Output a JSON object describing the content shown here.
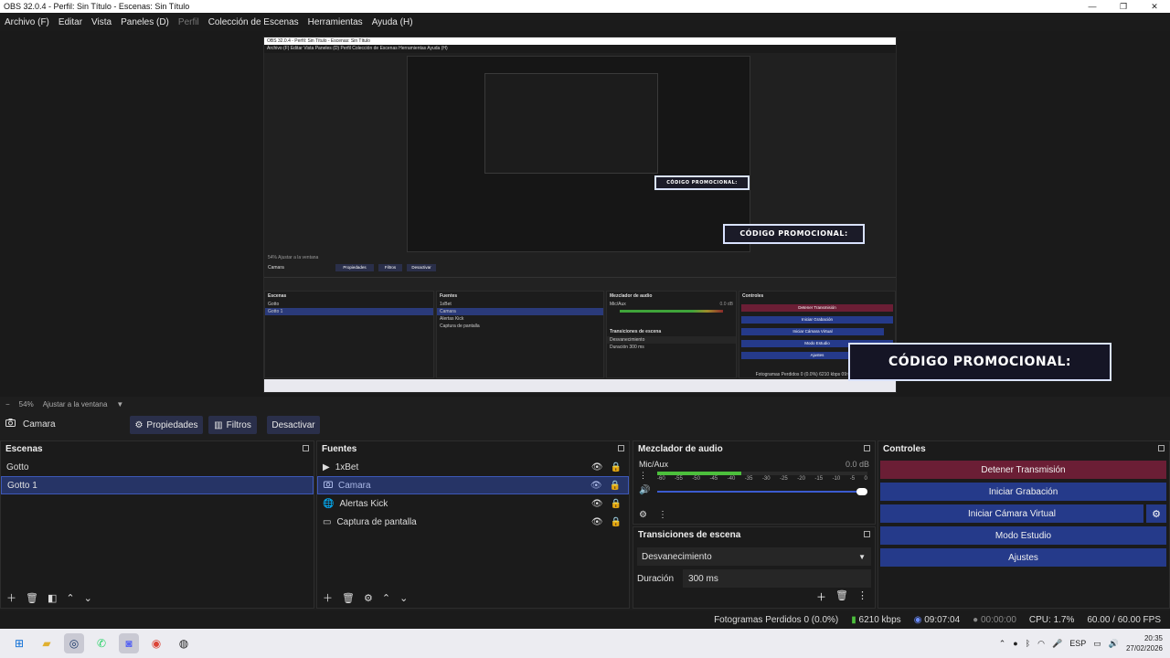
{
  "window": {
    "title": "OBS 32.0.4 - Perfil: Sin Título - Escenas: Sin Título",
    "controls": [
      "—",
      "❐",
      "✕"
    ]
  },
  "menu": [
    "Archivo (F)",
    "Editar",
    "Vista",
    "Paneles (D)",
    "Perfil",
    "Colección de Escenas",
    "Herramientas",
    "Ayuda (H)"
  ],
  "preview": {
    "promo_text": "CÓDIGO PROMOCIONAL:",
    "nested_title": "OBS 32.0.4 - Perfil: Sin Título - Escenas: Sin Título",
    "nested_menu": "Archivo (F)   Editar   Vista   Paneles (D)   Perfil   Colección de Escenas   Herramientas   Ayuda (H)",
    "nested_zoom": "54%    Ajustar a la ventana",
    "nested_camara": "Camara",
    "nested_propiedades": "Propiedades",
    "nested_filtros": "Filtros",
    "nested_desactivar": "Desactivar",
    "nested_escenas": "Escenas",
    "nested_scene1": "Gotto",
    "nested_scene2": "Gotto 1",
    "nested_fuentes": "Fuentes",
    "nested_sources": [
      "1xBet",
      "Camara",
      "Alertas Kick",
      "Captura de pantalla"
    ],
    "nested_mezclador": "Mezclador de audio",
    "nested_micaux": "Mic/Aux",
    "nested_db": "0.0 dB",
    "nested_transiciones": "Transiciones de escena",
    "nested_desvanecimiento": "Desvanecimiento",
    "nested_duracion": "Duración",
    "nested_ms": "300 ms",
    "nested_controles": "Controles",
    "nested_controls": [
      "Detener Transmisión",
      "Iniciar Grabación",
      "Iniciar Cámara Virtual",
      "Modo Estudio",
      "Ajustes"
    ],
    "nested_status": "Fotogramas Perdidos 0 (0.0%)   6210 kbps   09:07:04"
  },
  "zoom": {
    "value": "54%",
    "fit": "Ajustar a la ventana"
  },
  "source_bar": {
    "selected": "Camara",
    "properties": "Propiedades",
    "filters": "Filtros",
    "deactivate": "Desactivar"
  },
  "scenes": {
    "title": "Escenas",
    "items": [
      "Gotto",
      "Gotto 1"
    ],
    "selected_index": 1
  },
  "sources": {
    "title": "Fuentes",
    "items": [
      {
        "label": "1xBet",
        "icon": "play-icon"
      },
      {
        "label": "Camara",
        "icon": "camera-icon"
      },
      {
        "label": "Alertas Kick",
        "icon": "globe-icon"
      },
      {
        "label": "Captura de pantalla",
        "icon": "monitor-icon"
      }
    ],
    "selected_index": 1
  },
  "audio": {
    "title": "Mezclador de audio",
    "channel": "Mic/Aux",
    "db": "0.0 dB",
    "scale": [
      "-60",
      "-55",
      "-50",
      "-45",
      "-40",
      "-35",
      "-30",
      "-25",
      "-20",
      "-15",
      "-10",
      "-5",
      "0"
    ],
    "volume_fraction": 1.0
  },
  "transitions": {
    "title": "Transiciones de escena",
    "selected": "Desvanecimiento",
    "duration_label": "Duración",
    "duration_value": "300 ms"
  },
  "controls": {
    "title": "Controles",
    "stop_stream": "Detener Transmisión",
    "start_recording": "Iniciar Grabación",
    "virtual_cam": "Iniciar Cámara Virtual",
    "studio_mode": "Modo Estudio",
    "settings": "Ajustes"
  },
  "status": {
    "dropped": "Fotogramas Perdidos 0 (0.0%)",
    "kbps": "6210 kbps",
    "stream_time": "09:07:04",
    "rec_time": "00:00:00",
    "cpu": "CPU: 1.7%",
    "fps": "60.00 / 60.00 FPS"
  },
  "taskbar": {
    "lang": "ESP",
    "time": "20:35",
    "date": "27/02/2026"
  },
  "colors": {
    "stop_stream": "#6b1e35",
    "control_blue": "#253a8a",
    "selected_row": "#263466",
    "meter_green": "#4cbf3c"
  }
}
